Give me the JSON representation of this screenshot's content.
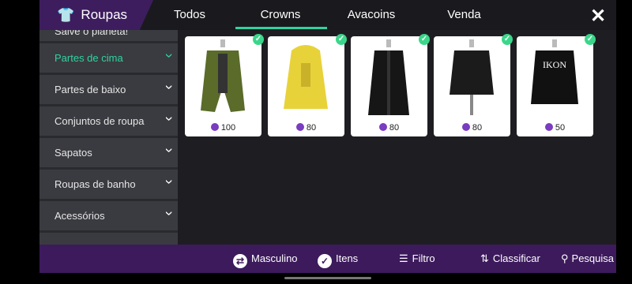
{
  "header": {
    "title": "Roupas",
    "shirt_icon": "shirt-icon",
    "close_label": "✕"
  },
  "tabs": [
    {
      "label": "Todos"
    },
    {
      "label": "Crowns"
    },
    {
      "label": "Avacoins"
    },
    {
      "label": "Venda"
    }
  ],
  "sidebar": {
    "items": [
      {
        "label": "Salve o planeta!"
      },
      {
        "label": "Partes de cima"
      },
      {
        "label": "Partes de baixo"
      },
      {
        "label": "Conjuntos de roupa"
      },
      {
        "label": "Sapatos"
      },
      {
        "label": "Roupas de banho"
      },
      {
        "label": "Acessórios"
      }
    ]
  },
  "items": [
    {
      "price": "100",
      "name": "green-jacket"
    },
    {
      "price": "80",
      "name": "yellow-hoodie"
    },
    {
      "price": "80",
      "name": "black-long-coat"
    },
    {
      "price": "80",
      "name": "black-leather-jacket"
    },
    {
      "price": "50",
      "name": "black-sweater"
    }
  ],
  "sweater_print": "IKON",
  "bottom": {
    "gender": "Masculino",
    "items": "Itens",
    "filter": "Filtro",
    "sort": "Classificar",
    "search": "Pesquisa"
  },
  "colors": {
    "accent": "#2fd3a0",
    "purple": "#3c1a5c",
    "coin": "#7a3cc0"
  }
}
